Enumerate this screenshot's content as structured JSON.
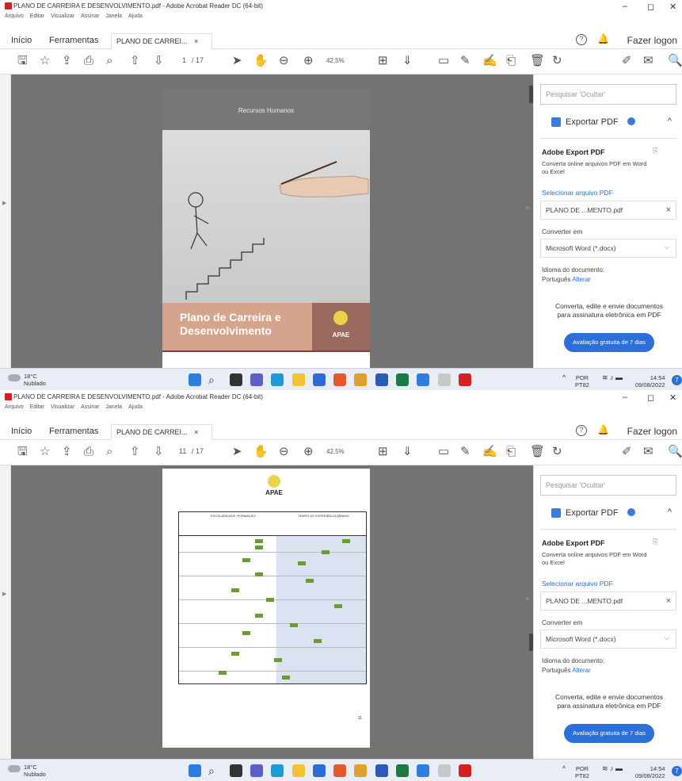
{
  "window": {
    "title": "PLANO DE CARREIRA E DESENVOLVIMENTO.pdf - Adobe Acrobat Reader DC (64-bit)",
    "minimize": "–",
    "restore": "◻",
    "close": "✕"
  },
  "menu": [
    "Arquivo",
    "Editar",
    "Visualizar",
    "Assinar",
    "Janela",
    "Ajuda"
  ],
  "tabs": {
    "home": "Início",
    "tools": "Ferramentas",
    "document": "PLANO DE CARREI...",
    "document_close": "×",
    "help": "?",
    "login": "Fazer logon"
  },
  "toolbar": {
    "zoom": "42,5%",
    "page_total": "/ 17",
    "page_current_top": "1",
    "page_current_bottom": "11"
  },
  "cover": {
    "header": "Recursos Humanos",
    "title": "Plano de Carreira e Desenvolvimento",
    "logo": "APAE"
  },
  "page11": {
    "logo": "APAE",
    "table_header_left": "ESCOLARIDADE /FORMAÇÃO",
    "table_header_right": "TEMPO DE EXPERIÊNCIA MÍNIMO",
    "page_number": "11"
  },
  "panel": {
    "search_placeholder": "Pesquisar 'Ocultar'",
    "export_title": "Exportar PDF",
    "caret": "^",
    "heading": "Adobe Export PDF",
    "description": "Converta online arquivos PDF em Word ou Excel",
    "select_link": "Selecionar arquivo PDF",
    "file_name": "PLANO DE ...MENTO.pdf",
    "file_remove": "×",
    "convert_label": "Converter em",
    "format": "Microsoft Word (*.docx)",
    "format_caret": "⌵",
    "language_label": "Idioma do documento:",
    "language_value": "Português",
    "language_change": "Alterar",
    "promo": "Converta, edite e envie documentos para assinatura eletrônica em PDF",
    "trial_button": "Avaliação gratuita de 7 dias"
  },
  "taskbar": {
    "temp": "18°C",
    "weather": "Nublado",
    "lang1": "POR",
    "lang2": "PT82",
    "time": "14:54",
    "date": "09/08/2022",
    "notifications": "7"
  },
  "colors": {
    "accent": "#2d6fd9",
    "viewer_bg": "#737373",
    "cover_footer": "#d4a48c",
    "table_green": "#6a9a3a"
  }
}
